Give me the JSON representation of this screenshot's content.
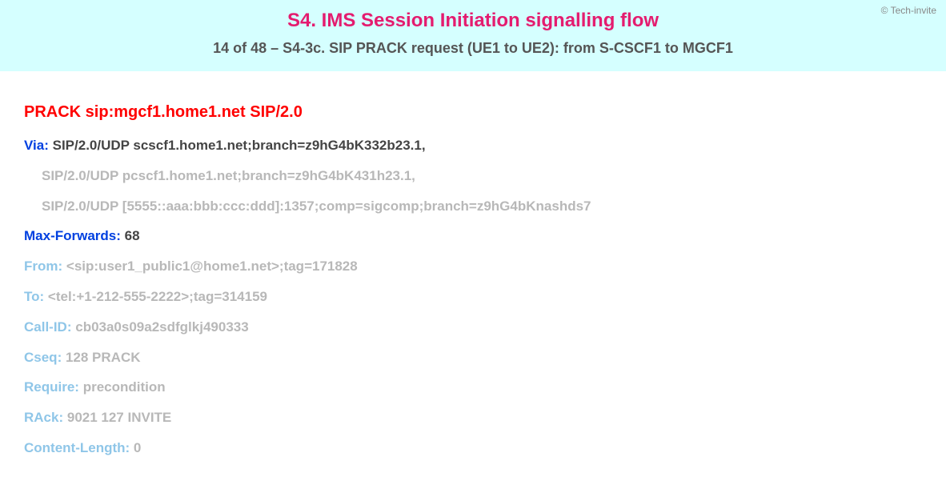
{
  "copyright": "© Tech-invite",
  "title": "S4. IMS Session Initiation signalling flow",
  "subtitle": "14 of 48 – S4-3c. SIP PRACK request (UE1 to UE2): from S-CSCF1 to MGCF1",
  "request_line": "PRACK sip:mgcf1.home1.net SIP/2.0",
  "headers": {
    "via": {
      "name": "Via:",
      "value1": "SIP/2.0/UDP scscf1.home1.net;branch=z9hG4bK332b23.1,",
      "value2": "SIP/2.0/UDP pcscf1.home1.net;branch=z9hG4bK431h23.1,",
      "value3": "SIP/2.0/UDP [5555::aaa:bbb:ccc:ddd]:1357;comp=sigcomp;branch=z9hG4bKnashds7"
    },
    "max_forwards": {
      "name": "Max-Forwards:",
      "value": "68"
    },
    "from": {
      "name": "From:",
      "value": "<sip:user1_public1@home1.net>;tag=171828"
    },
    "to": {
      "name": "To:",
      "value": "<tel:+1-212-555-2222>;tag=314159"
    },
    "call_id": {
      "name": "Call-ID:",
      "value": "cb03a0s09a2sdfglkj490333"
    },
    "cseq": {
      "name": "Cseq:",
      "value": "128 PRACK"
    },
    "require": {
      "name": "Require:",
      "value": "precondition"
    },
    "rack": {
      "name": "RAck:",
      "value": "9021 127 INVITE"
    },
    "content_length": {
      "name": "Content-Length:",
      "value": "0"
    }
  }
}
